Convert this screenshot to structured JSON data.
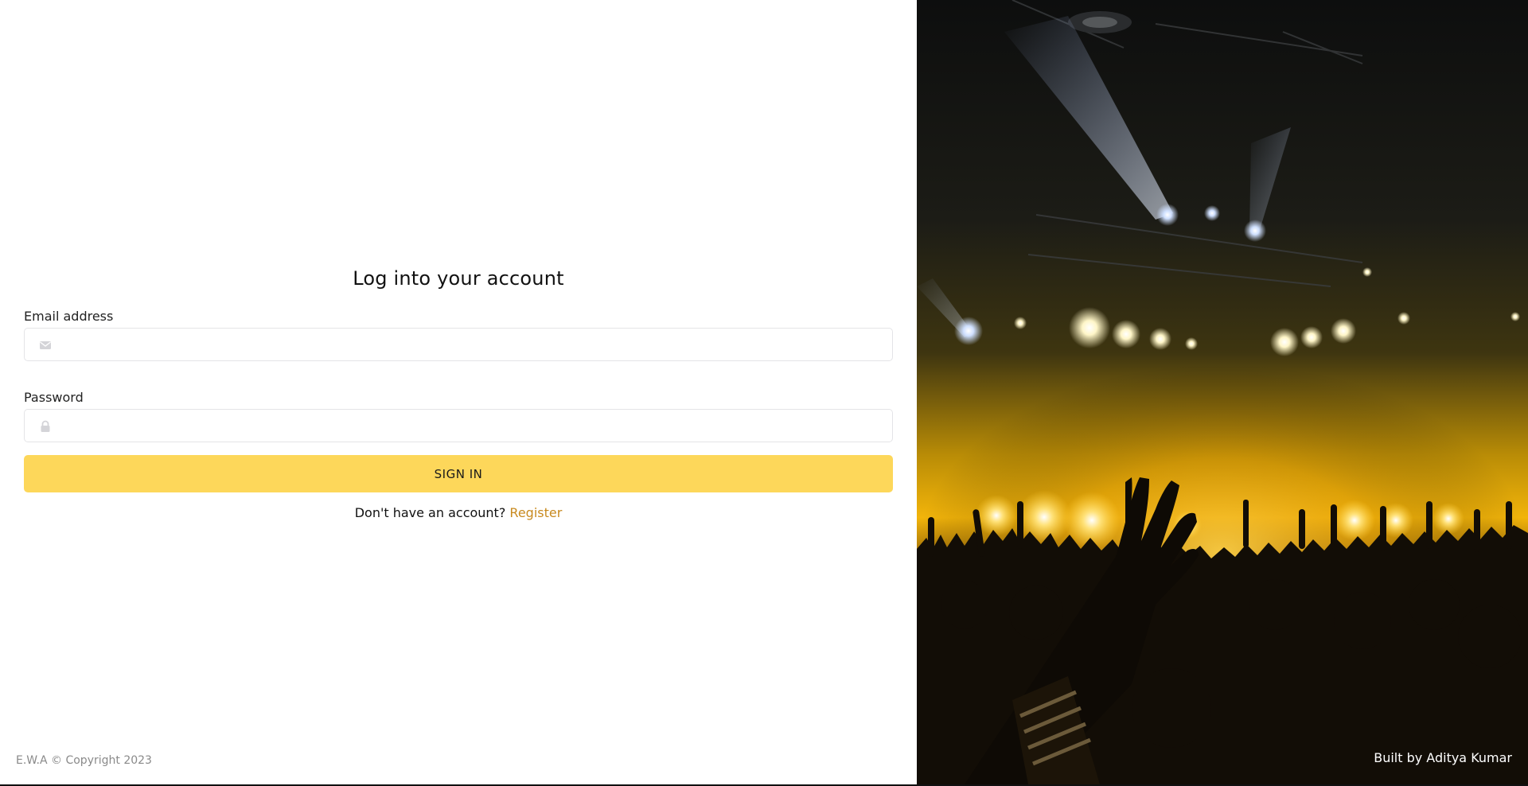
{
  "login": {
    "title": "Log into your account",
    "email_label": "Email address",
    "email_value": "",
    "email_placeholder": "",
    "password_label": "Password",
    "password_value": "",
    "password_placeholder": "",
    "submit_label": "SIGN IN",
    "register_prompt": "Don't have an account?",
    "register_link": "Register"
  },
  "footer": {
    "copyright": "E.W.A © Copyright 2023",
    "credit": "Built by Aditya Kumar"
  },
  "icons": {
    "email": "envelope-icon",
    "password": "lock-icon"
  },
  "colors": {
    "accent": "#fdd75a",
    "link": "#c88a1f",
    "input_border": "#e4e4e7"
  }
}
